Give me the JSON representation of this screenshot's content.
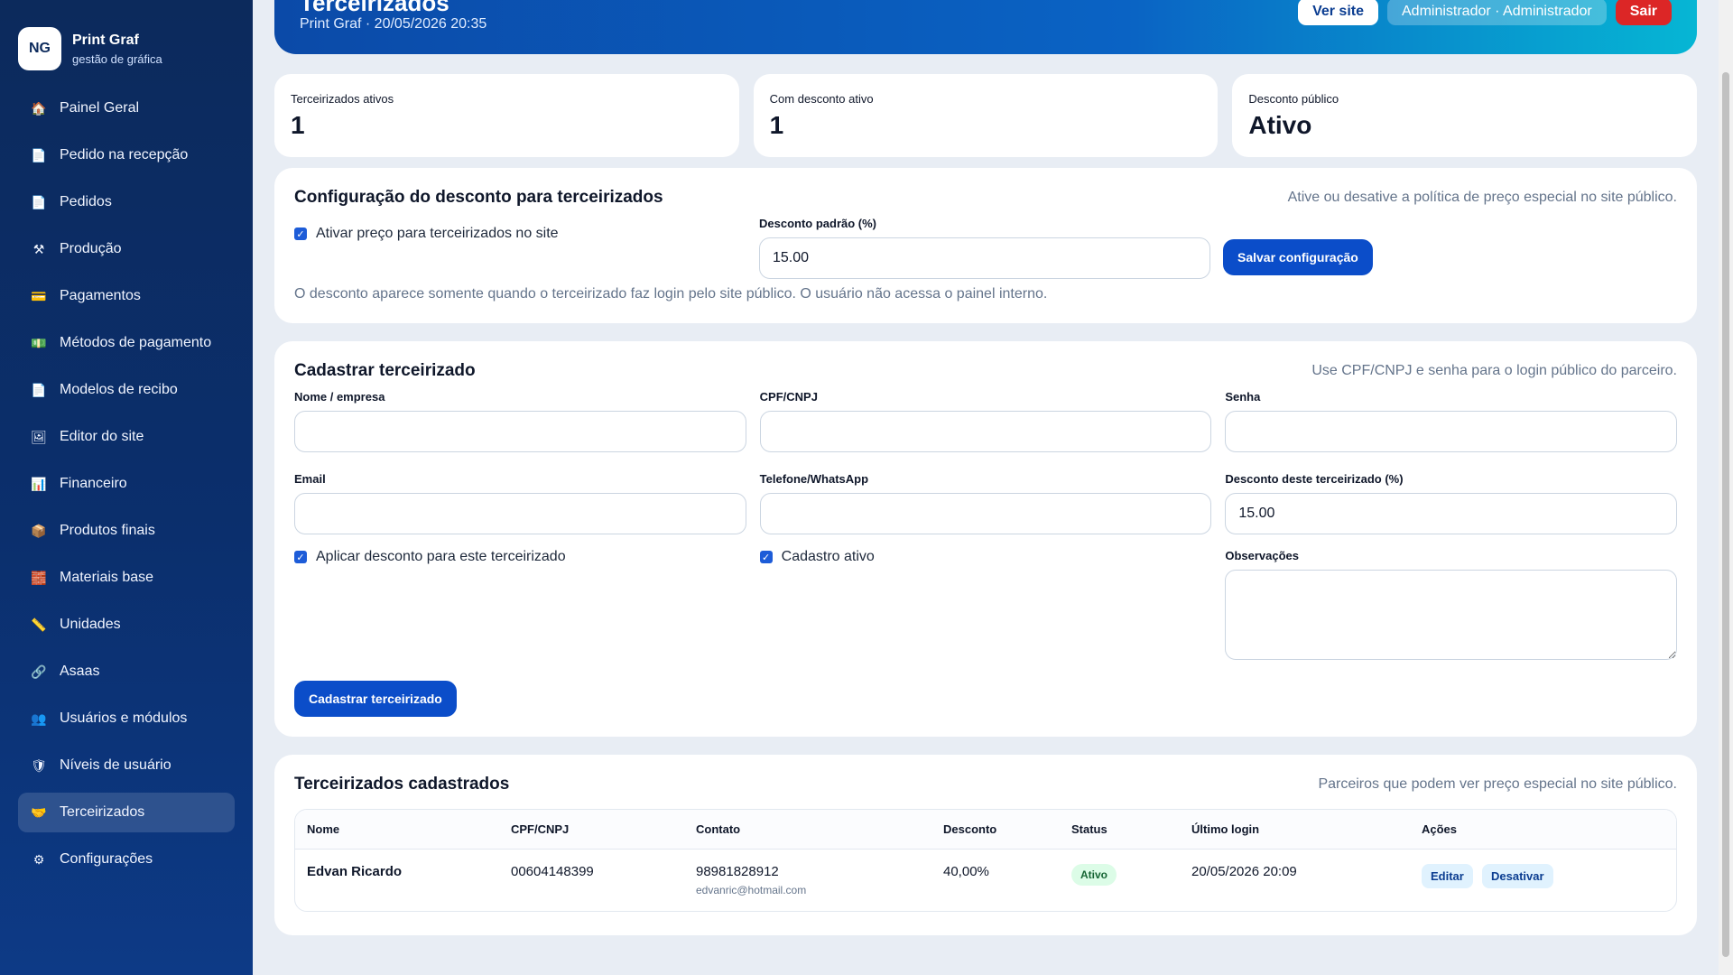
{
  "brand": {
    "initials": "NG",
    "name": "Print Graf",
    "subtitle": "gestão de gráfica"
  },
  "sidebar": {
    "items": [
      {
        "label": "Painel Geral",
        "icon": "🏠",
        "icon_name": "home-icon"
      },
      {
        "label": "Pedido na recepção",
        "icon": "📄",
        "icon_name": "document-icon"
      },
      {
        "label": "Pedidos",
        "icon": "📄",
        "icon_name": "document-icon"
      },
      {
        "label": "Produção",
        "icon": "⚒",
        "icon_name": "tools-icon"
      },
      {
        "label": "Pagamentos",
        "icon": "💳",
        "icon_name": "card-icon"
      },
      {
        "label": "Métodos de pagamento",
        "icon": "💵",
        "icon_name": "cash-icon"
      },
      {
        "label": "Modelos de recibo",
        "icon": "📄",
        "icon_name": "document-icon"
      },
      {
        "label": "Editor do site",
        "icon": "🖼",
        "icon_name": "image-icon"
      },
      {
        "label": "Financeiro",
        "icon": "📊",
        "icon_name": "chart-icon"
      },
      {
        "label": "Produtos finais",
        "icon": "📦",
        "icon_name": "package-icon"
      },
      {
        "label": "Materiais base",
        "icon": "🧱",
        "icon_name": "materials-icon"
      },
      {
        "label": "Unidades",
        "icon": "📏",
        "icon_name": "ruler-icon"
      },
      {
        "label": "Asaas",
        "icon": "🔗",
        "icon_name": "link-icon"
      },
      {
        "label": "Usuários e módulos",
        "icon": "👥",
        "icon_name": "users-icon"
      },
      {
        "label": "Níveis de usuário",
        "icon": "🛡",
        "icon_name": "shield-icon"
      },
      {
        "label": "Terceirizados",
        "icon": "🤝",
        "icon_name": "handshake-icon"
      },
      {
        "label": "Configurações",
        "icon": "⚙",
        "icon_name": "gear-icon"
      }
    ],
    "active_index": 15
  },
  "header": {
    "title": "Terceirizados",
    "subtitle": "Print Graf · 20/05/2026 20:35",
    "ver_site": "Ver site",
    "user": "Administrador · Administrador",
    "sair": "Sair"
  },
  "stats": [
    {
      "label": "Terceirizados ativos",
      "value": "1"
    },
    {
      "label": "Com desconto ativo",
      "value": "1"
    },
    {
      "label": "Desconto público",
      "value": "Ativo"
    }
  ],
  "config": {
    "title": "Configuração do desconto para terceirizados",
    "note": "Ative ou desative a política de preço especial no site público.",
    "checkbox_label": "Ativar preço para terceirizados no site",
    "discount_label": "Desconto padrão (%)",
    "discount_value": "15.00",
    "save_button": "Salvar configuração",
    "help": "O desconto aparece somente quando o terceirizado faz login pelo site público. O usuário não acessa o painel interno."
  },
  "register": {
    "title": "Cadastrar terceirizado",
    "note": "Use CPF/CNPJ e senha para o login público do parceiro.",
    "nome_label": "Nome / empresa",
    "cpf_label": "CPF/CNPJ",
    "senha_label": "Senha",
    "email_label": "Email",
    "telefone_label": "Telefone/WhatsApp",
    "desconto_label": "Desconto deste terceirizado (%)",
    "desconto_value": "15.00",
    "aplicar_label": "Aplicar desconto para este terceirizado",
    "ativo_label": "Cadastro ativo",
    "obs_label": "Observações",
    "submit_button": "Cadastrar terceirizado"
  },
  "list": {
    "title": "Terceirizados cadastrados",
    "note": "Parceiros que podem ver preço especial no site público.",
    "columns": [
      "Nome",
      "CPF/CNPJ",
      "Contato",
      "Desconto",
      "Status",
      "Último login",
      "Ações"
    ],
    "rows": [
      {
        "nome": "Edvan Ricardo",
        "cpf": "00604148399",
        "telefone": "98981828912",
        "email": "edvanric@hotmail.com",
        "desconto": "40,00%",
        "status": "Ativo",
        "ultimo_login": "20/05/2026 20:09",
        "editar": "Editar",
        "desativar": "Desativar"
      }
    ]
  },
  "colors": {
    "accent": "#0b4dc9",
    "sidebar": "#0c2a5c",
    "danger": "#dc2626",
    "success": "#166534"
  }
}
